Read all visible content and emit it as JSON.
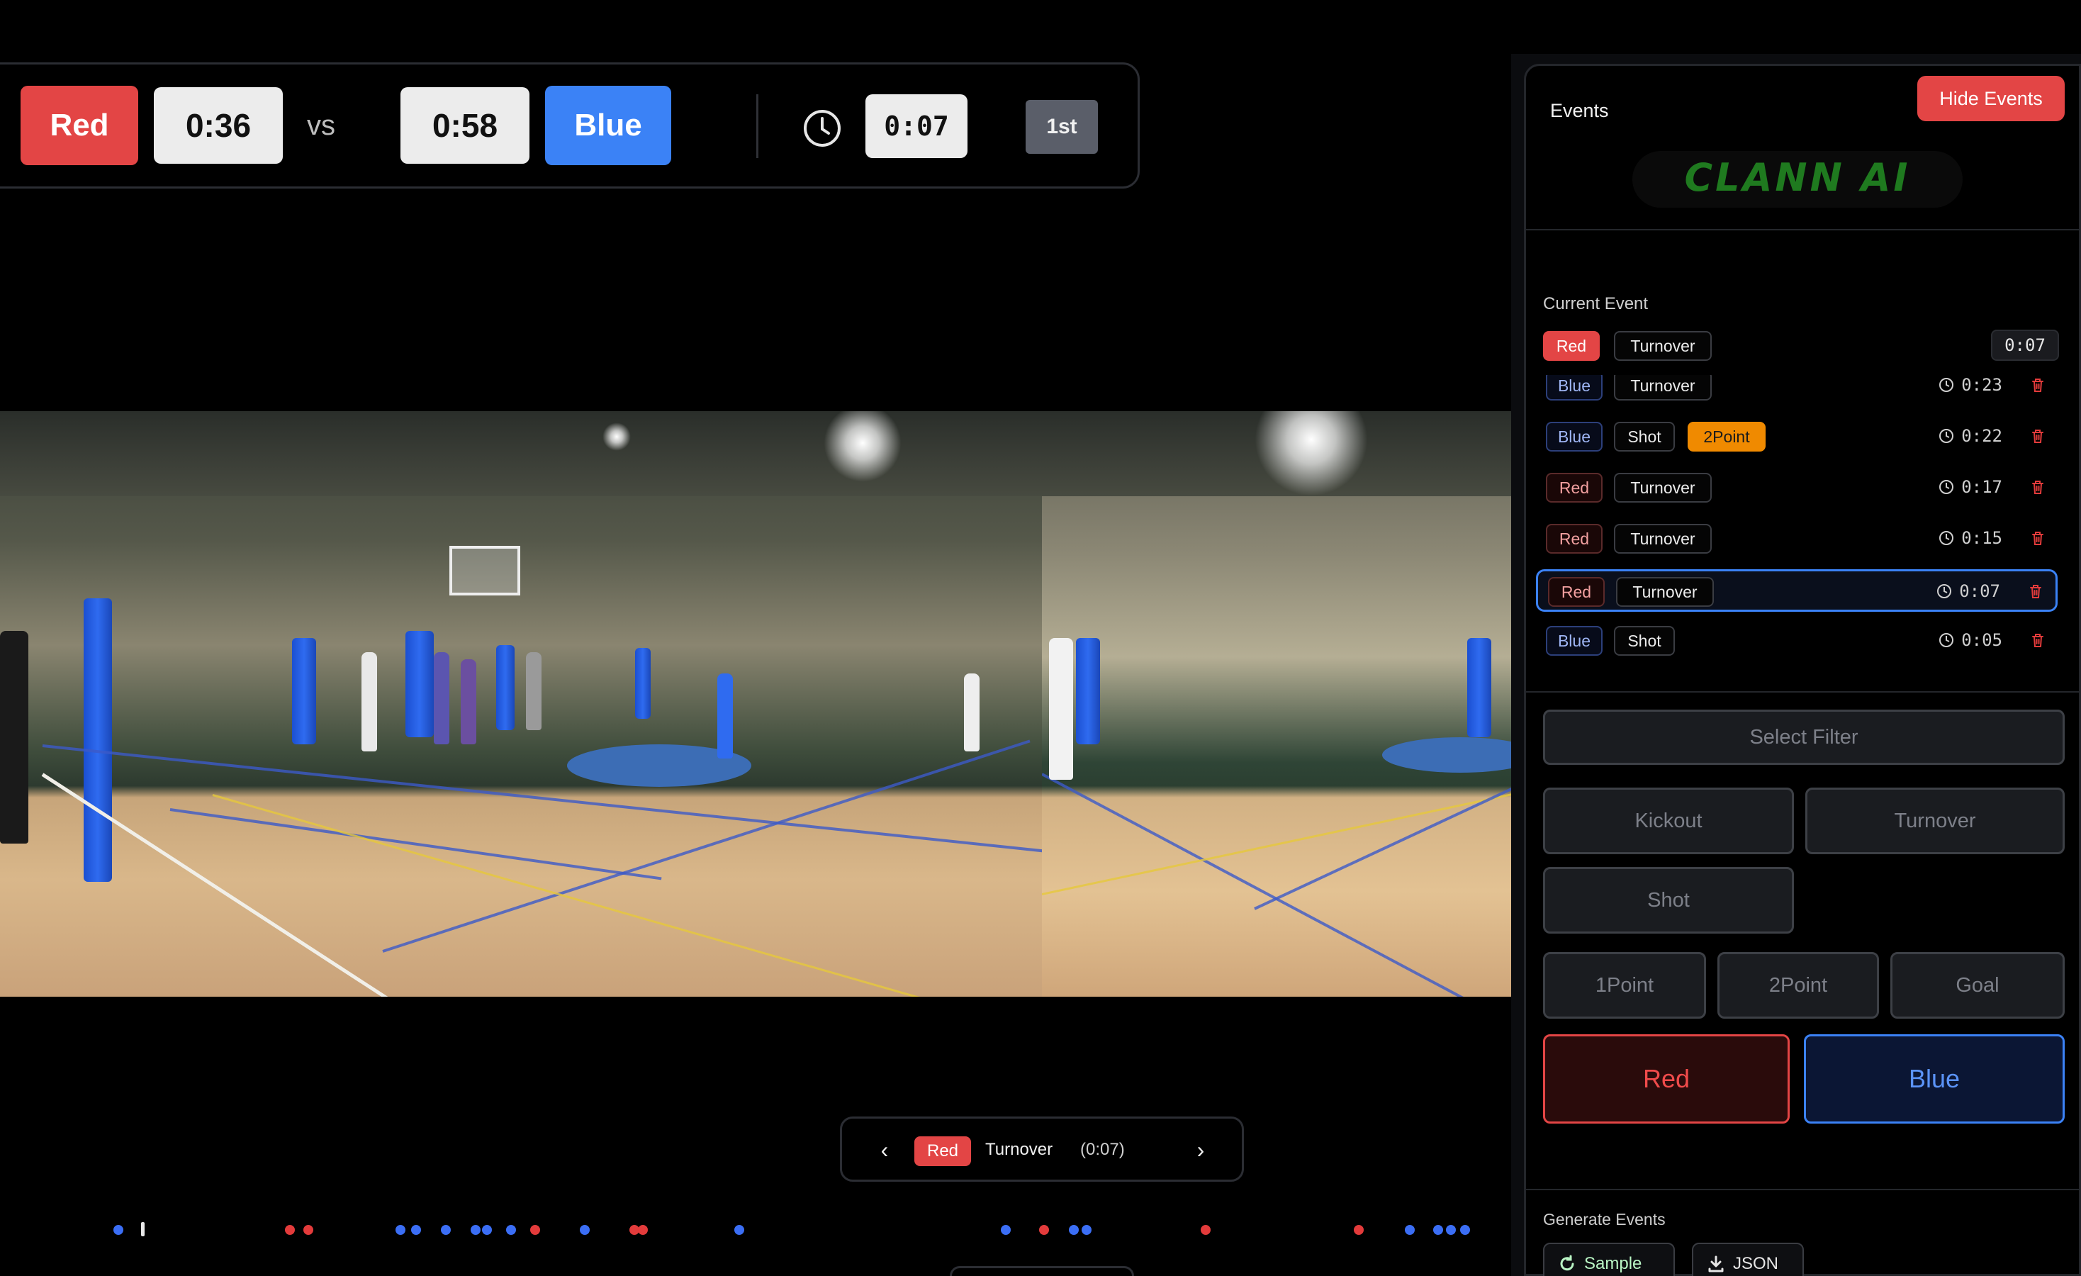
{
  "scoreboard": {
    "team_red": "Red",
    "score_red": "0:36",
    "vs": "vs",
    "score_blue": "0:58",
    "team_blue": "Blue",
    "game_clock": "0:07",
    "period": "1st"
  },
  "event_nav": {
    "team": "Red",
    "type": "Turnover",
    "time": "(0:07)"
  },
  "events_panel": {
    "title": "Events",
    "hide_button": "Hide Events",
    "logo_text": "CLANN AI",
    "current_event": {
      "label": "Current Event",
      "team": "Red",
      "type": "Turnover",
      "time": "0:07"
    },
    "events": [
      {
        "team": "Blue",
        "tags": [
          "Turnover"
        ],
        "time": "0:23"
      },
      {
        "team": "Blue",
        "tags": [
          "Shot",
          "2Point"
        ],
        "time": "0:22"
      },
      {
        "team": "Red",
        "tags": [
          "Turnover"
        ],
        "time": "0:17"
      },
      {
        "team": "Red",
        "tags": [
          "Turnover"
        ],
        "time": "0:15"
      },
      {
        "team": "Red",
        "tags": [
          "Turnover"
        ],
        "time": "0:07",
        "selected": true
      },
      {
        "team": "Blue",
        "tags": [
          "Shot"
        ],
        "time": "0:05"
      }
    ],
    "controls": {
      "select_filter": "Select Filter",
      "kickout": "Kickout",
      "turnover": "Turnover",
      "shot": "Shot",
      "one_point": "1Point",
      "two_point": "2Point",
      "goal": "Goal",
      "red": "Red",
      "blue": "Blue"
    },
    "generate": {
      "label": "Generate Events",
      "sample": "Sample",
      "json": "JSON"
    }
  },
  "timeline_dots": [
    "blue",
    "red",
    "red",
    "blue",
    "blue",
    "blue",
    "blue",
    "blue",
    "blue",
    "red",
    "blue",
    "red",
    "red",
    "blue",
    "blue",
    "red",
    "blue",
    "blue",
    "red",
    "red",
    "blue",
    "blue",
    "blue",
    "blue"
  ],
  "colors": {
    "red": "#e34545",
    "blue": "#3b82f6",
    "orange": "#f08a00",
    "brand_green": "#1f7a1f"
  }
}
